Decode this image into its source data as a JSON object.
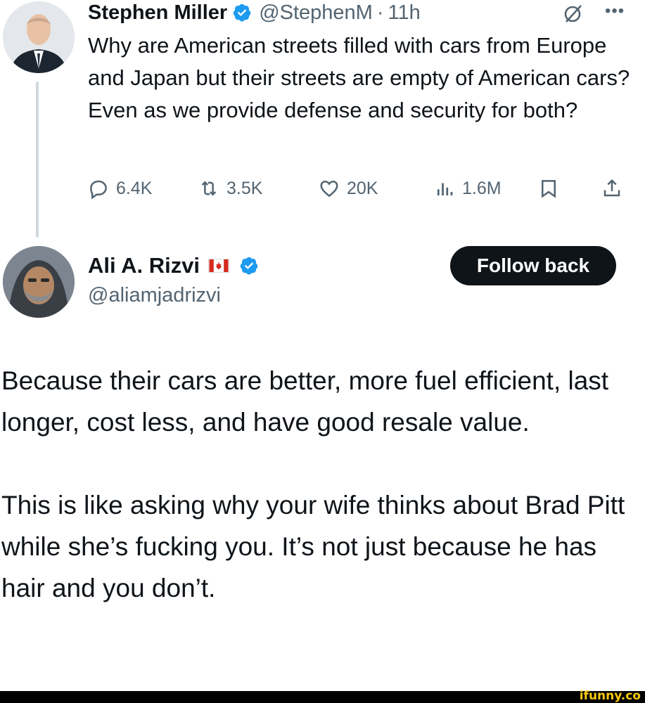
{
  "tweet": {
    "author": "Stephen Miller",
    "handle": "@StephenM",
    "separator": "·",
    "time": "11h",
    "text": "Why are American streets filled with cars from Europe and Japan but their streets are empty of American cars? Even as we provide defense and security for both?",
    "stats": {
      "replies": "6.4K",
      "reposts": "3.5K",
      "likes": "20K",
      "views": "1.6M"
    }
  },
  "reply": {
    "author": "Ali A. Rizvi",
    "handle": "@aliamjadrizvi",
    "follow_label": "Follow back",
    "paragraphs": [
      "Because their cars are better, more fuel efficient, last longer, cost less, and have good resale value.",
      "This is like asking why your wife thinks about Brad Pitt while she’s fucking you. It’s not just because he has hair and you don’t."
    ]
  },
  "watermark": "ifunny.co",
  "colors": {
    "verified": "#1d9bf0",
    "text": "#0f1419",
    "secondary": "#536471",
    "thread_line": "#cfd9de",
    "button_bg": "#0f1419"
  },
  "icons": [
    "verified-badge-icon",
    "grok-icon",
    "more-icon",
    "reply-icon",
    "repost-icon",
    "like-icon",
    "views-icon",
    "bookmark-icon",
    "share-icon",
    "canada-flag-icon"
  ]
}
